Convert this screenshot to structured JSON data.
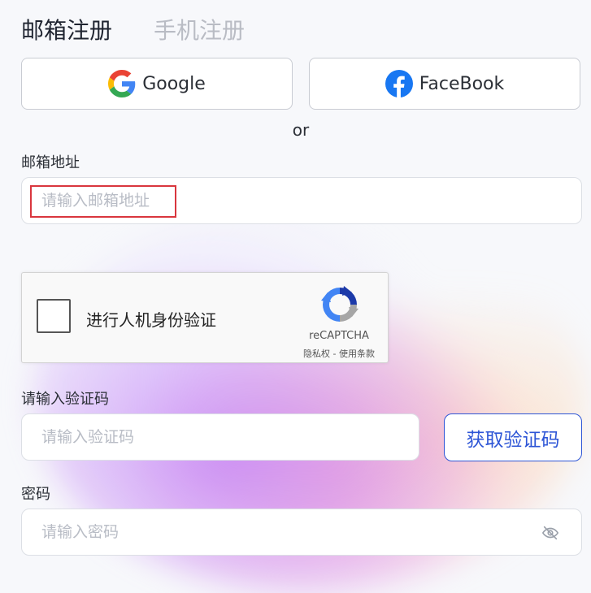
{
  "tabs": {
    "email_register": "邮箱注册",
    "phone_register": "手机注册"
  },
  "social": {
    "google_label": "Google",
    "facebook_label": "FaceBook",
    "or_text": "or"
  },
  "email": {
    "label": "邮箱地址",
    "placeholder": "请输入邮箱地址",
    "value": ""
  },
  "captcha": {
    "check_label": "进行人机身份验证",
    "brand": "reCAPTCHA",
    "links": "隐私权 - 使用条款"
  },
  "verification": {
    "label": "请输入验证码",
    "placeholder": "请输入验证码",
    "value": "",
    "get_code_label": "获取验证码"
  },
  "password": {
    "label": "密码",
    "placeholder": "请输入密码",
    "value": ""
  },
  "colors": {
    "accent": "#2d55d6",
    "highlight": "#d9363e",
    "google_blue": "#4285F4",
    "google_red": "#EA4335",
    "google_yellow": "#FBBC05",
    "google_green": "#34A853",
    "facebook": "#1877F2"
  },
  "icons": {
    "google": "google-logo-icon",
    "facebook": "facebook-logo-icon",
    "recaptcha": "recaptcha-logo-icon",
    "password_visibility": "eye-off-icon"
  }
}
